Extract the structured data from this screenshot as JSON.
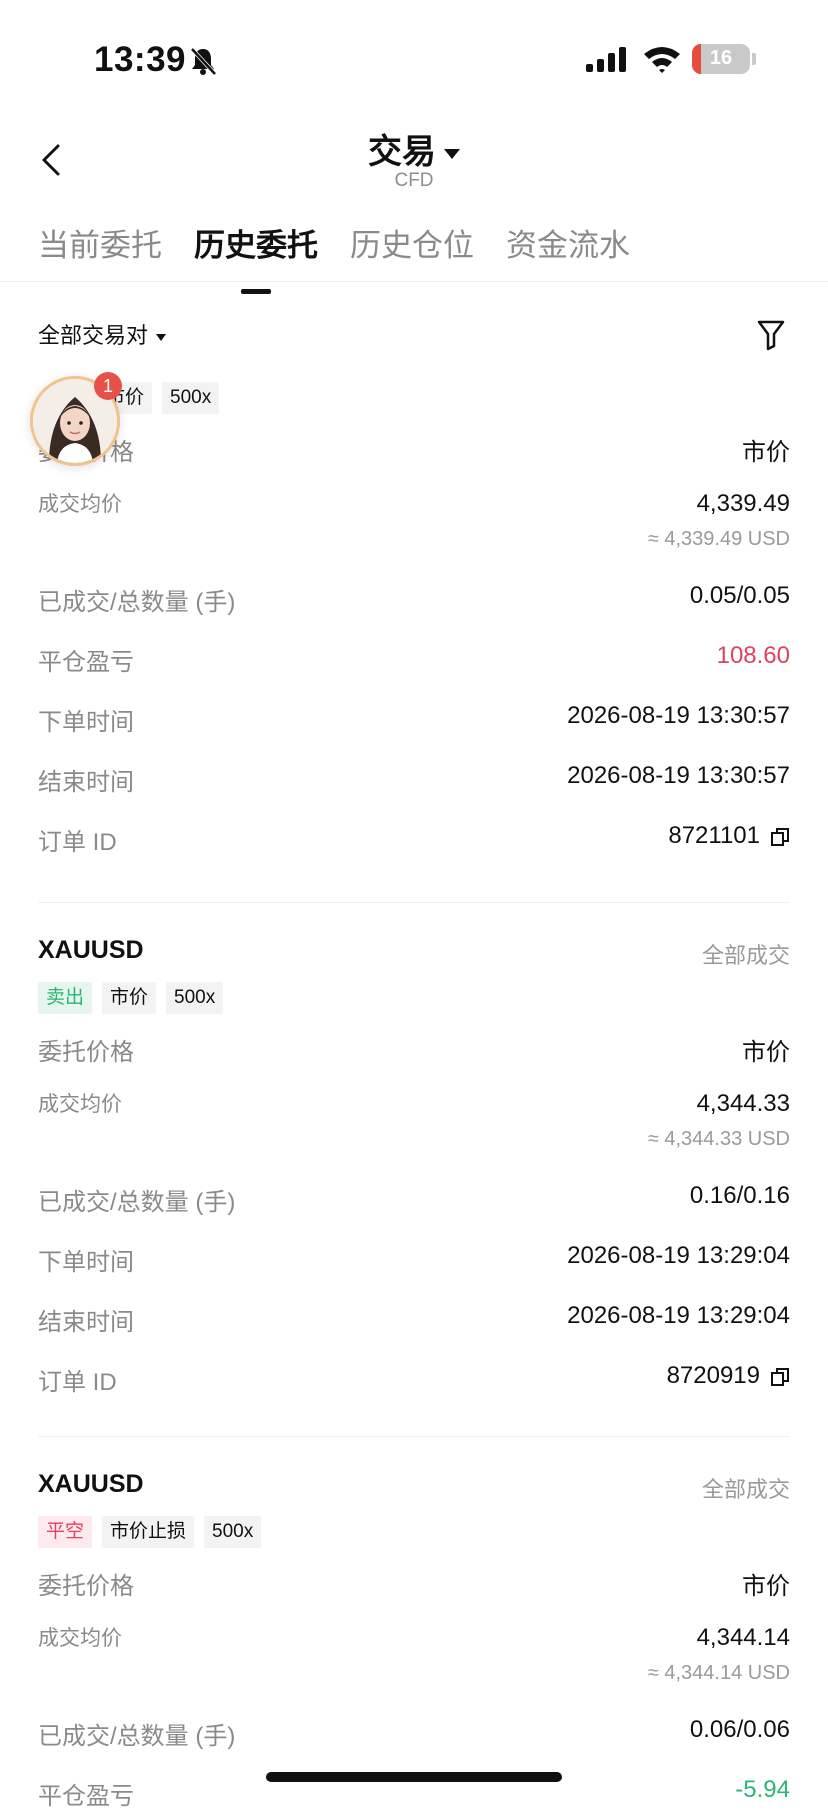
{
  "status_bar": {
    "time": "13:39",
    "battery": "16"
  },
  "header": {
    "title": "交易",
    "subtitle": "CFD"
  },
  "tabs": [
    {
      "label": "当前委托",
      "active": false
    },
    {
      "label": "历史委托",
      "active": true
    },
    {
      "label": "历史仓位",
      "active": false
    },
    {
      "label": "资金流水",
      "active": false
    }
  ],
  "filter": {
    "pair_label": "全部交易对"
  },
  "floating_avatar": {
    "badge": "1"
  },
  "orders": [
    {
      "tags": [
        "市价",
        "500x"
      ],
      "rows": {
        "order_price": {
          "label": "委托价格",
          "value": "市价"
        },
        "avg_price": {
          "label": "成交均价",
          "value": "4,339.49",
          "sub": "≈ 4,339.49 USD"
        },
        "filled": {
          "label": "已成交/总数量 (手)",
          "value": "0.05/0.05"
        },
        "pnl": {
          "label": "平仓盈亏",
          "value": "108.60"
        },
        "order_time": {
          "label": "下单时间",
          "value": "2026-08-19 13:30:57"
        },
        "end_time": {
          "label": "结束时间",
          "value": "2026-08-19 13:30:57"
        },
        "order_id": {
          "label": "订单 ID",
          "value": "8721101"
        }
      }
    },
    {
      "symbol": "XAUUSD",
      "status": "全部成交",
      "tags": [
        "卖出",
        "市价",
        "500x"
      ],
      "rows": {
        "order_price": {
          "label": "委托价格",
          "value": "市价"
        },
        "avg_price": {
          "label": "成交均价",
          "value": "4,344.33",
          "sub": "≈ 4,344.33 USD"
        },
        "filled": {
          "label": "已成交/总数量 (手)",
          "value": "0.16/0.16"
        },
        "order_time": {
          "label": "下单时间",
          "value": "2026-08-19 13:29:04"
        },
        "end_time": {
          "label": "结束时间",
          "value": "2026-08-19 13:29:04"
        },
        "order_id": {
          "label": "订单 ID",
          "value": "8720919"
        }
      }
    },
    {
      "symbol": "XAUUSD",
      "status": "全部成交",
      "tags": [
        "平空",
        "市价止损",
        "500x"
      ],
      "rows": {
        "order_price": {
          "label": "委托价格",
          "value": "市价"
        },
        "avg_price": {
          "label": "成交均价",
          "value": "4,344.14",
          "sub": "≈ 4,344.14 USD"
        },
        "filled": {
          "label": "已成交/总数量 (手)",
          "value": "0.06/0.06"
        },
        "pnl": {
          "label": "平仓盈亏",
          "value": "-5.94"
        }
      }
    }
  ],
  "colors": {
    "profit": "#e0435f",
    "loss": "#2bb673",
    "sell_tag": "#2bb673",
    "close_short_tag": "#e0435f"
  }
}
